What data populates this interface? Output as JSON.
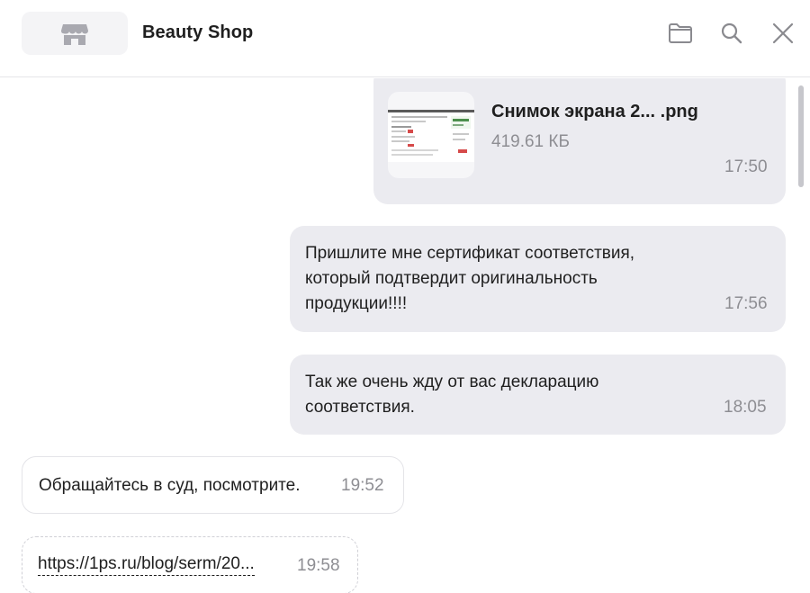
{
  "header": {
    "title": "Beauty Shop",
    "avatar_icon": "store-icon",
    "actions": [
      {
        "name": "folder-icon",
        "label": "Files"
      },
      {
        "name": "search-icon",
        "label": "Search"
      },
      {
        "name": "close-icon",
        "label": "Close"
      }
    ]
  },
  "messages": {
    "file": {
      "name": "Снимок экрана 2...  .png",
      "size": "419.61 КБ",
      "time": "17:50"
    },
    "cert": {
      "lines": [
        "Пришлите мне сертификат соответствия,",
        "который подтвердит оригинальность",
        "продукции!!!!"
      ],
      "time": "17:56"
    },
    "decl": {
      "lines": [
        "Так же очень жду от вас декларацию",
        "соответствия."
      ],
      "time": "18:05"
    },
    "reply": {
      "text": "Обращайтесь в суд, посмотрите.",
      "time": "19:52"
    },
    "link": {
      "text": "https://1ps.ru/blog/serm/20...",
      "time": "19:58"
    }
  },
  "colors": {
    "outgoing_bubble": "#ebebf0",
    "incoming_bubble": "#ffffff",
    "muted_text": "#8e8e93"
  }
}
